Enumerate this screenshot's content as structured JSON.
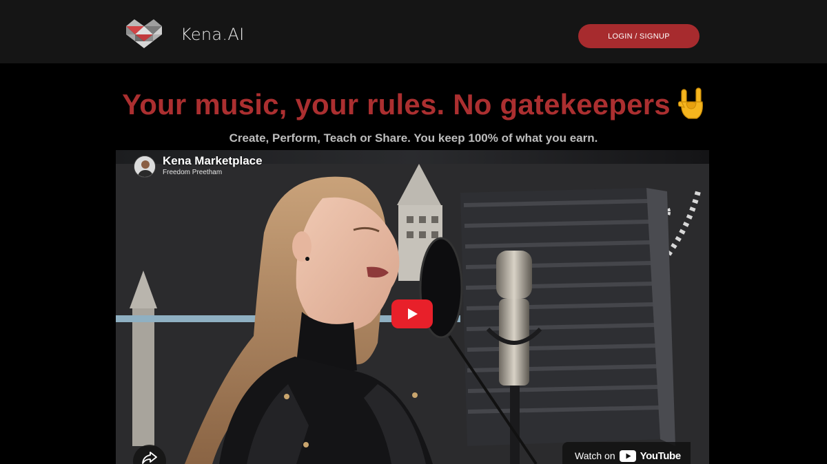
{
  "header": {
    "brand": "Kena.AI",
    "login_label": "LOGIN / SIGNUP",
    "logo_icon": "heart-geometric-logo-icon"
  },
  "hero": {
    "headline": "Your music, your rules. No gatekeepers",
    "headline_emoji": "sign-of-horns-emoji",
    "subheadline": "Create, Perform, Teach or Share. You keep 100% of what you earn."
  },
  "video": {
    "title": "Kena Marketplace",
    "channel": "Freedom Preetham",
    "watch_on": "Watch on",
    "platform": "YouTube"
  },
  "colors": {
    "accent": "#a72b2e",
    "headline": "#ab2f30",
    "header_bg": "#151515",
    "page_bg": "#000000",
    "play_button": "#e8202a"
  }
}
